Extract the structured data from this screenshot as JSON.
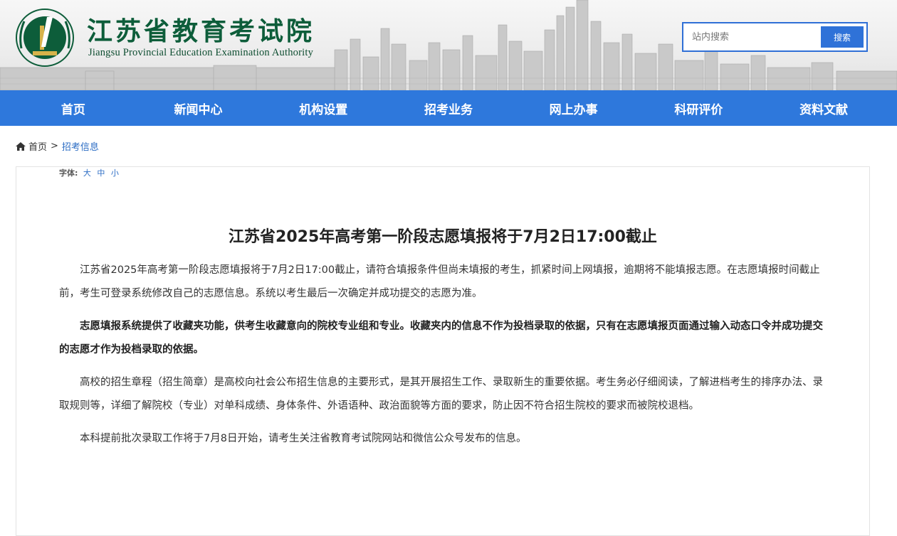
{
  "header": {
    "org_name_cn": "江苏省教育考试院",
    "org_name_en": "Jiangsu Provincial Education Examination Authority",
    "search_placeholder": "站内搜索",
    "search_button": "搜索",
    "brand_color": "#0d5d3a",
    "accent_color": "#2e78dc"
  },
  "nav": {
    "items": [
      "首页",
      "新闻中心",
      "机构设置",
      "招考业务",
      "网上办事",
      "科研评价",
      "资料文献"
    ]
  },
  "breadcrumb": {
    "home": "首页",
    "separator": ">",
    "current": "招考信息"
  },
  "article": {
    "font_size_label": "字体:",
    "font_size_options": [
      "大",
      "中",
      "小"
    ],
    "title": "江苏省2025年高考第一阶段志愿填报将于7月2日17:00截止",
    "paragraphs": [
      "江苏省2025年高考第一阶段志愿填报将于7月2日17:00截止，请符合填报条件但尚未填报的考生，抓紧时间上网填报，逾期将不能填报志愿。在志愿填报时间截止前，考生可登录系统修改自己的志愿信息。系统以考生最后一次确定并成功提交的志愿为准。",
      "志愿填报系统提供了收藏夹功能，供考生收藏意向的院校专业组和专业。收藏夹内的信息不作为投档录取的依据，只有在志愿填报页面通过输入动态口令并成功提交的志愿才作为投档录取的依据。",
      "高校的招生章程（招生简章）是高校向社会公布招生信息的主要形式，是其开展招生工作、录取新生的重要依据。考生务必仔细阅读，了解进档考生的排序办法、录取规则等，详细了解院校（专业）对单科成绩、身体条件、外语语种、政治面貌等方面的要求，防止因不符合招生院校的要求而被院校退档。",
      "本科提前批次录取工作将于7月8日开始，请考生关注省教育考试院网站和微信公众号发布的信息。"
    ]
  }
}
